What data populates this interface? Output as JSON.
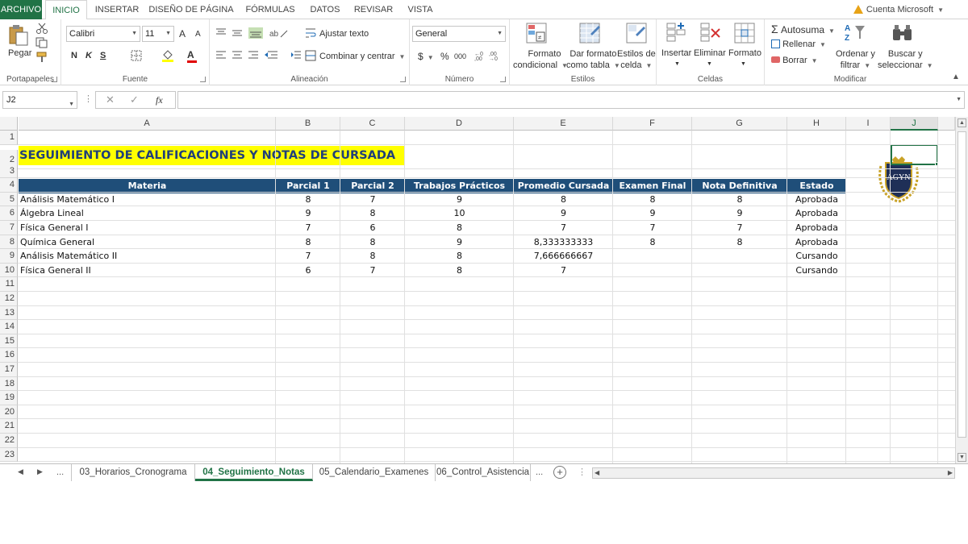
{
  "ribbon_tabs": {
    "file": "ARCHIVO",
    "items": [
      "INICIO",
      "INSERTAR",
      "DISEÑO DE PÁGINA",
      "FÓRMULAS",
      "DATOS",
      "REVISAR",
      "VISTA"
    ],
    "active": "INICIO"
  },
  "account": {
    "label": "Cuenta Microsoft"
  },
  "ribbon": {
    "clipboard": {
      "paste": "Pegar",
      "group": "Portapapeles"
    },
    "font": {
      "name": "Calibri",
      "size": "11",
      "bold": "N",
      "italic": "K",
      "underline": "S",
      "grow": "A",
      "shrink": "A",
      "color_a": "A",
      "group": "Fuente"
    },
    "alignment": {
      "wrap": "Ajustar texto",
      "merge": "Combinar y centrar",
      "group": "Alineación"
    },
    "number": {
      "format": "General",
      "currency": "$",
      "percent": "%",
      "thousands": "000",
      "group": "Número"
    },
    "styles": {
      "conditional_1": "Formato",
      "conditional_2": "condicional",
      "table_1": "Dar formato",
      "table_2": "como tabla",
      "cell_1": "Estilos de",
      "cell_2": "celda",
      "group": "Estilos"
    },
    "cells": {
      "insert": "Insertar",
      "delete": "Eliminar",
      "format": "Formato",
      "group": "Celdas"
    },
    "editing": {
      "autosum": "Autosuma",
      "fill": "Rellenar",
      "clear": "Borrar",
      "sort_1": "Ordenar y",
      "sort_2": "filtrar",
      "find_1": "Buscar y",
      "find_2": "seleccionar",
      "group": "Modificar"
    }
  },
  "formula_bar": {
    "name_box": "J2",
    "fx": "fx",
    "value": ""
  },
  "columns": [
    "A",
    "B",
    "C",
    "D",
    "E",
    "F",
    "G",
    "H",
    "I",
    "J"
  ],
  "selected_column": "J",
  "rows": [
    "1",
    "2",
    "3",
    "4",
    "5",
    "6",
    "7",
    "8",
    "9",
    "10",
    "11",
    "12",
    "13",
    "14",
    "15",
    "16",
    "17",
    "18",
    "19",
    "20",
    "21",
    "22",
    "23"
  ],
  "sheet": {
    "title": "SEGUIMIENTO DE CALIFICACIONES Y NOTAS DE CURSADA",
    "headers": [
      "Materia",
      "Parcial 1",
      "Parcial 2",
      "Trabajos Prácticos",
      "Promedio Cursada",
      "Examen Final",
      "Nota Definitiva",
      "Estado"
    ],
    "data": [
      [
        "Análisis Matemático I",
        "8",
        "7",
        "9",
        "8",
        "8",
        "8",
        "Aprobada"
      ],
      [
        "Álgebra Lineal",
        "9",
        "8",
        "10",
        "9",
        "9",
        "9",
        "Aprobada"
      ],
      [
        "Física General I",
        "7",
        "6",
        "8",
        "7",
        "7",
        "7",
        "Aprobada"
      ],
      [
        "Química General",
        "8",
        "8",
        "9",
        "8,333333333",
        "8",
        "8",
        "Aprobada"
      ],
      [
        "Análisis Matemático II",
        "7",
        "8",
        "8",
        "7,666666667",
        "",
        "",
        "Cursando"
      ],
      [
        "Física General II",
        "6",
        "7",
        "8",
        "7",
        "",
        "",
        "Cursando"
      ]
    ],
    "logo_text": "AGYN"
  },
  "sheet_tabs": {
    "ellipsis": "...",
    "items": [
      "03_Horarios_Cronograma",
      "04_Seguimiento_Notas",
      "05_Calendario_Examenes",
      "06_Control_Asistencia"
    ],
    "active": "04_Seguimiento_Notas",
    "more": "..."
  },
  "colors": {
    "excel_green": "#217346",
    "header_blue": "#1f4e79",
    "title_yellow": "#ffff00",
    "title_text": "#1f3f7a"
  }
}
